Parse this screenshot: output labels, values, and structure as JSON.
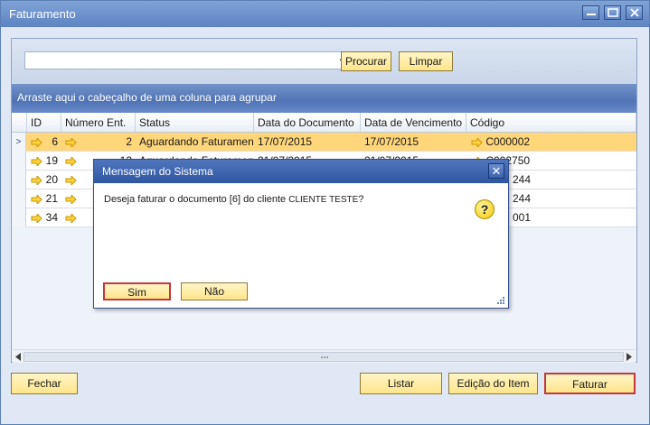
{
  "window": {
    "title": "Faturamento"
  },
  "search": {
    "value": "",
    "search_label": "Procurar",
    "clear_label": "Limpar"
  },
  "group_hint": "Arraste aqui o cabeçalho de uma coluna para agrupar",
  "columns": [
    "ID",
    "Número Ent.",
    "Status",
    "Data do Documento",
    "Data de Vencimento",
    "Código"
  ],
  "rows": [
    {
      "id": "6",
      "num": "2",
      "status": "Aguardando Faturamento",
      "doc_date": "17/07/2015",
      "due_date": "17/07/2015",
      "code": "C000002"
    },
    {
      "id": "19",
      "num": "12",
      "status": "Aguardando Faturamento",
      "doc_date": "21/07/2015",
      "due_date": "21/07/2015",
      "code": "C002750"
    },
    {
      "id": "20",
      "num": "",
      "status": "",
      "doc_date": "",
      "due_date": "",
      "code": "244"
    },
    {
      "id": "21",
      "num": "",
      "status": "",
      "doc_date": "",
      "due_date": "",
      "code": "244"
    },
    {
      "id": "34",
      "num": "",
      "status": "",
      "doc_date": "",
      "due_date": "",
      "code": "001"
    }
  ],
  "footer": {
    "close": "Fechar",
    "list": "Listar",
    "edit": "Edição do Item",
    "bill": "Faturar"
  },
  "dialog": {
    "title": "Mensagem do Sistema",
    "message_start": "Deseja faturar o documento [6] do cliente ",
    "client": "CLIENTE TESTE",
    "message_end": "?",
    "yes": "Sim",
    "no": "Não"
  },
  "colors": {
    "selected_row": "#ffd679",
    "button": "#ffe58a",
    "default_border": "#c0393c",
    "title_bar": "#5d83c2"
  }
}
